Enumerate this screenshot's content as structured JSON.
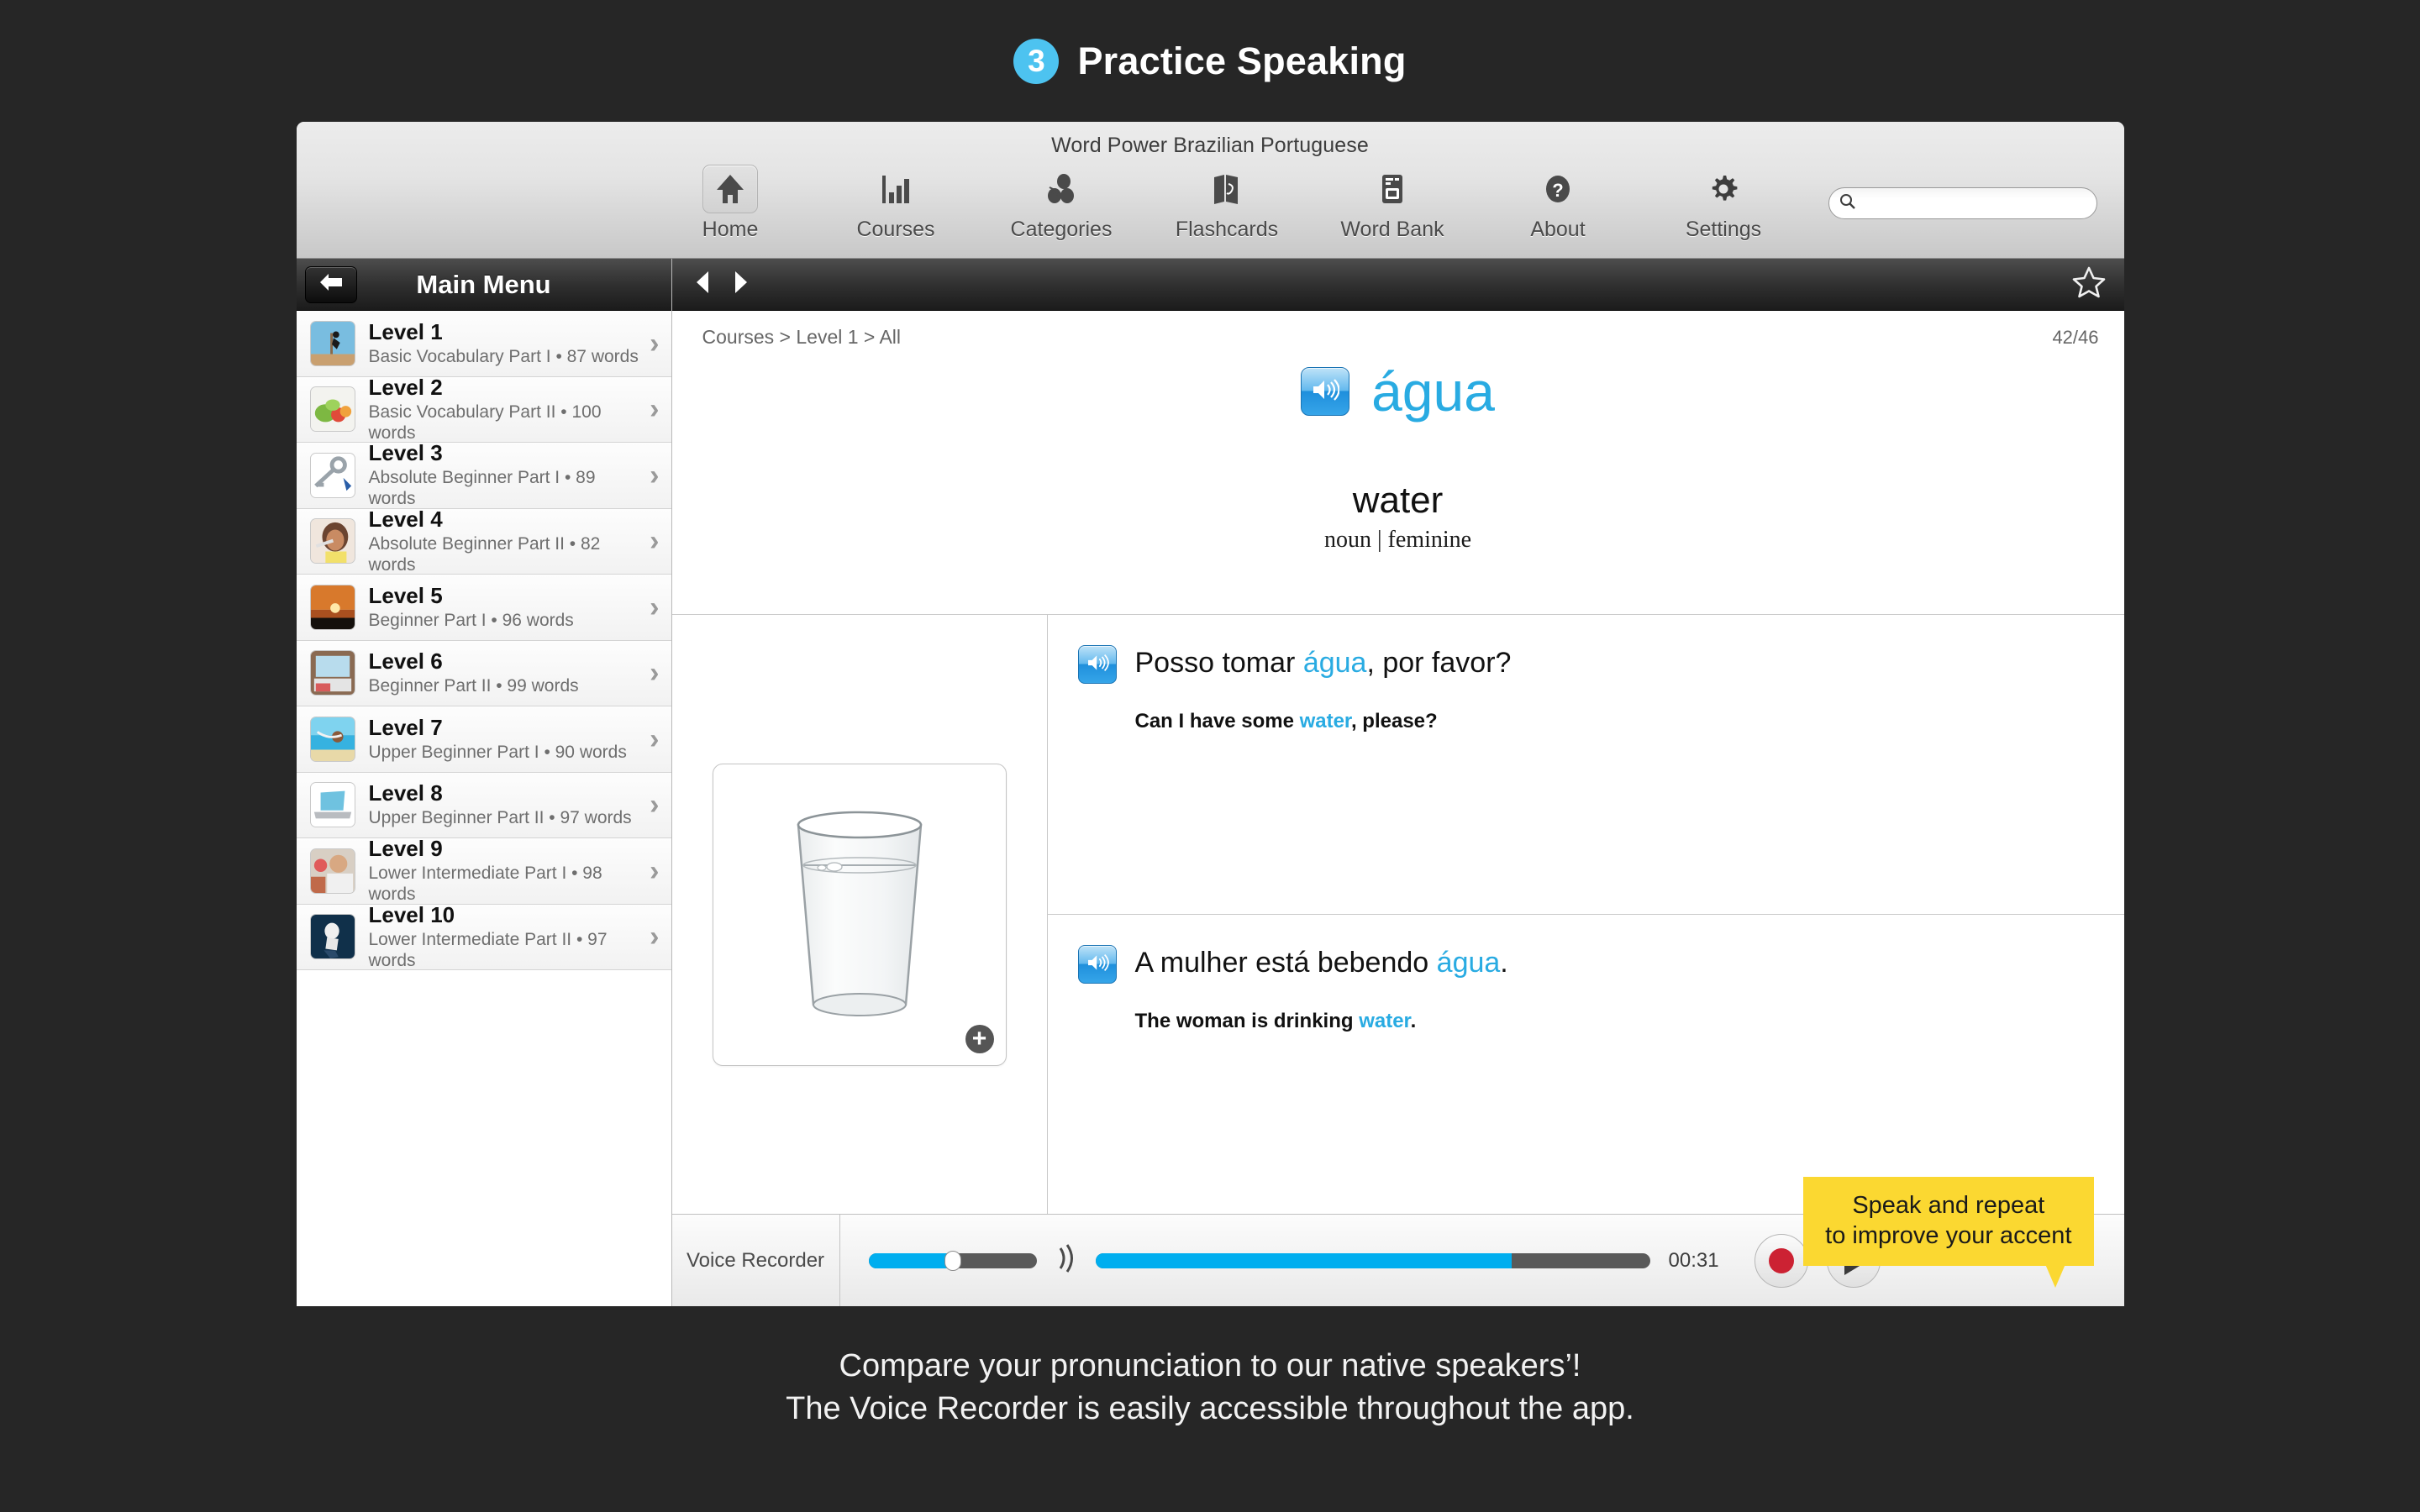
{
  "header": {
    "step_number": "3",
    "title": "Practice Speaking"
  },
  "window": {
    "title": "Word Power Brazilian Portuguese"
  },
  "toolbar": {
    "items": [
      {
        "label": "Home",
        "icon": "home-icon",
        "selected": true
      },
      {
        "label": "Courses",
        "icon": "bar-chart-icon",
        "selected": false
      },
      {
        "label": "Categories",
        "icon": "categories-icon",
        "selected": false
      },
      {
        "label": "Flashcards",
        "icon": "flashcards-icon",
        "selected": false
      },
      {
        "label": "Word Bank",
        "icon": "word-bank-icon",
        "selected": false
      },
      {
        "label": "About",
        "icon": "question-mark-icon",
        "selected": false
      },
      {
        "label": "Settings",
        "icon": "gear-icon",
        "selected": false
      }
    ],
    "search_value": "",
    "search_placeholder": ""
  },
  "sidebar": {
    "title": "Main Menu",
    "back_label": "Back",
    "levels": [
      {
        "name": "Level 1",
        "desc": "Basic Vocabulary Part I • 87 words"
      },
      {
        "name": "Level 2",
        "desc": "Basic Vocabulary Part II • 100 words"
      },
      {
        "name": "Level 3",
        "desc": "Absolute Beginner Part I • 89 words"
      },
      {
        "name": "Level 4",
        "desc": "Absolute Beginner Part II • 82 words"
      },
      {
        "name": "Level 5",
        "desc": "Beginner Part I • 96 words"
      },
      {
        "name": "Level 6",
        "desc": "Beginner Part II • 99 words"
      },
      {
        "name": "Level 7",
        "desc": "Upper Beginner Part I • 90 words"
      },
      {
        "name": "Level 8",
        "desc": "Upper Beginner Part II • 97 words"
      },
      {
        "name": "Level 9",
        "desc": "Lower Intermediate Part I • 98 words"
      },
      {
        "name": "Level 10",
        "desc": "Lower Intermediate Part II • 97 words"
      }
    ]
  },
  "content": {
    "breadcrumb": "Courses > Level 1 > All",
    "counter": "42/46",
    "headword": "água",
    "translation": "water",
    "part_of_speech": "noun | feminine",
    "sentences": [
      {
        "target_pre": "Posso tomar ",
        "target_highlight": "água",
        "target_post": ", por favor?",
        "native_pre": "Can I have some ",
        "native_highlight": "water",
        "native_post": ", please?"
      },
      {
        "target_pre": "A mulher está bebendo ",
        "target_highlight": "água",
        "target_post": ".",
        "native_pre": "The woman is drinking ",
        "native_highlight": "water",
        "native_post": "."
      }
    ],
    "tooltip_line1": "Speak and repeat",
    "tooltip_line2": "to improve your accent",
    "image_alt": "glass of water"
  },
  "recorder": {
    "label": "Voice Recorder",
    "time": "00:31",
    "volume_percent": 50,
    "progress_percent": 75,
    "record_label": "Record",
    "play_label": "Play"
  },
  "caption": {
    "line1": "Compare your pronunciation to our native speakers’!",
    "line2": "The Voice Recorder is easily accessible throughout the app."
  },
  "colors": {
    "accent_blue": "#29ABE2",
    "badge_blue": "#4DC3F0",
    "tooltip_yellow": "#FBD831",
    "record_red": "#CC2233",
    "slider_blue": "#00AEEF",
    "page_background": "#262626"
  }
}
